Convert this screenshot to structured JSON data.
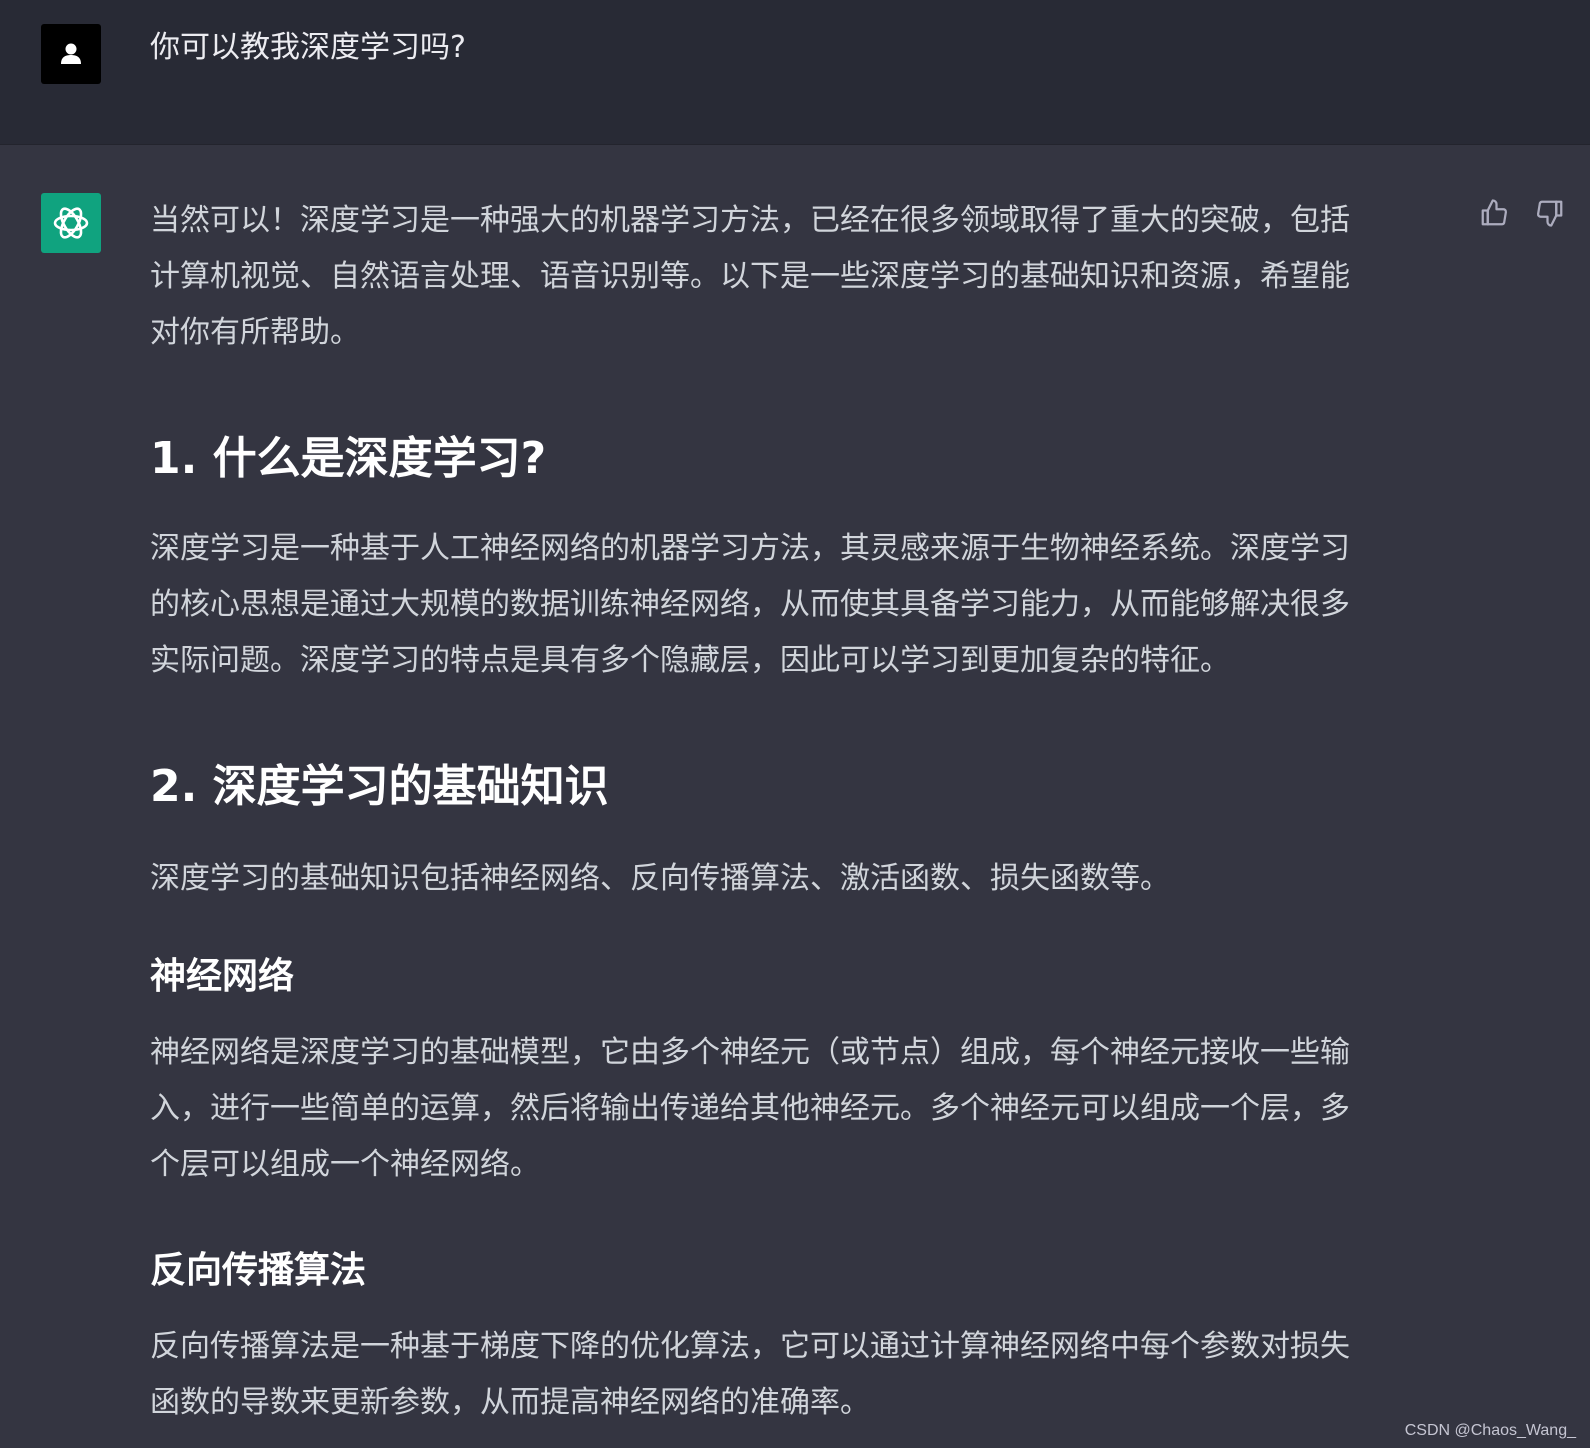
{
  "user_message": {
    "avatar_icon": "user-icon",
    "text": "你可以教我深度学习吗?"
  },
  "assistant_message": {
    "avatar_icon": "openai-logo-icon",
    "accent_color": "#10a37f",
    "intro": [
      "当然可以！深度学习是一种强大的机器学习方法，已经在很多领域取得了重大的突破，包括",
      "计算机视觉、自然语言处理、语音识别等。以下是一些深度学习的基础知识和资源，希望能",
      "对你有所帮助。"
    ],
    "section1": {
      "heading": "1. 什么是深度学习?",
      "body": [
        "深度学习是一种基于人工神经网络的机器学习方法，其灵感来源于生物神经系统。深度学习",
        "的核心思想是通过大规模的数据训练神经网络，从而使其具备学习能力，从而能够解决很多",
        "实际问题。深度学习的特点是具有多个隐藏层，因此可以学习到更加复杂的特征。"
      ]
    },
    "section2": {
      "heading": "2. 深度学习的基础知识",
      "body": "深度学习的基础知识包括神经网络、反向传播算法、激活函数、损失函数等。",
      "sub1": {
        "heading": "神经网络",
        "body": [
          "神经网络是深度学习的基础模型，它由多个神经元（或节点）组成，每个神经元接收一些输",
          "入，进行一些简单的运算，然后将输出传递给其他神经元。多个神经元可以组成一个层，多",
          "个层可以组成一个神经网络。"
        ]
      },
      "sub2": {
        "heading": "反向传播算法",
        "body": [
          "反向传播算法是一种基于梯度下降的优化算法，它可以通过计算神经网络中每个参数对损失",
          "函数的导数来更新参数，从而提高神经网络的准确率。"
        ]
      }
    },
    "actions": {
      "thumbs_up_icon": "thumbs-up-icon",
      "thumbs_down_icon": "thumbs-down-icon"
    }
  },
  "watermark": "CSDN @Chaos_Wang_"
}
